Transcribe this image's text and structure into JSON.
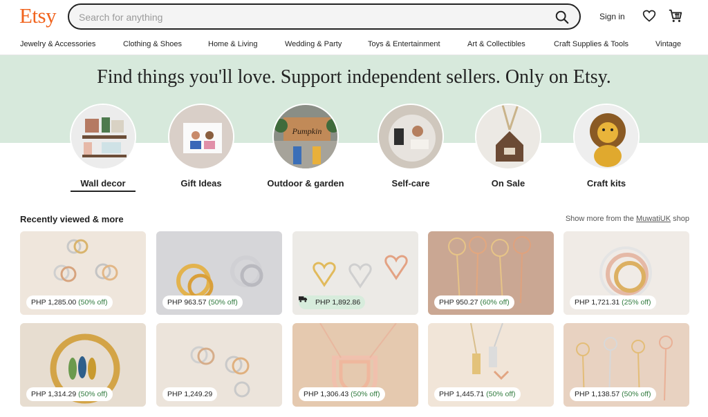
{
  "header": {
    "logo": "Etsy",
    "search_placeholder": "Search for anything",
    "sign_in": "Sign in",
    "icons": [
      "search-icon",
      "heart-icon",
      "cart-icon"
    ]
  },
  "nav": {
    "items": [
      "Jewelry & Accessories",
      "Clothing & Shoes",
      "Home & Living",
      "Wedding & Party",
      "Toys & Entertainment",
      "Art & Collectibles",
      "Craft Supplies & Tools",
      "Vintage"
    ]
  },
  "hero": {
    "headline": "Find things you'll love. Support independent sellers. Only on Etsy.",
    "categories": [
      {
        "label": "Wall decor",
        "selected": true
      },
      {
        "label": "Gift Ideas"
      },
      {
        "label": "Outdoor & garden"
      },
      {
        "label": "Self-care"
      },
      {
        "label": "On Sale"
      },
      {
        "label": "Craft kits"
      }
    ]
  },
  "recent": {
    "title": "Recently viewed & more",
    "more_prefix": "Show more from the",
    "more_shop": "MuwatiUK",
    "more_suffix": "shop",
    "items": [
      {
        "price": "PHP 1,285.00",
        "discount": "(50% off)"
      },
      {
        "price": "PHP 963.57",
        "discount": "(50% off)"
      },
      {
        "price": "PHP 1,892.86",
        "discount": "",
        "free_shipping": true
      },
      {
        "price": "PHP 950.27",
        "discount": "(60% off)"
      },
      {
        "price": "PHP 1,721.31",
        "discount": "(25% off)"
      },
      {
        "price": "PHP 1,314.29",
        "discount": "(50% off)"
      },
      {
        "price": "PHP 1,249.29",
        "discount": ""
      },
      {
        "price": "PHP 1,306.43",
        "discount": "(50% off)"
      },
      {
        "price": "PHP 1,445.71",
        "discount": "(50% off)"
      },
      {
        "price": "PHP 1,138.57",
        "discount": "(50% off)"
      }
    ]
  },
  "colors": {
    "brand": "#f1641e",
    "hero_bg": "#d7e9dc",
    "discount": "#2f7a3d"
  }
}
